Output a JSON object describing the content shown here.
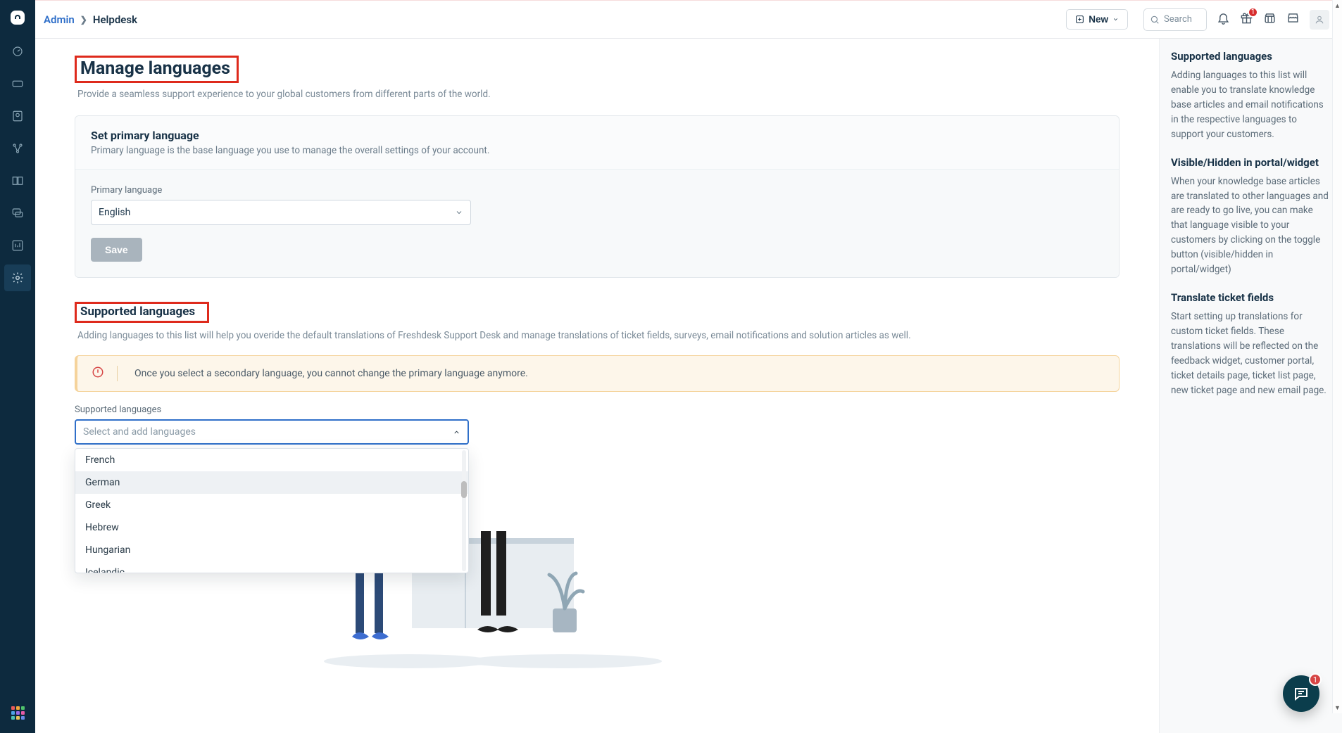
{
  "breadcrumb": {
    "admin": "Admin",
    "current": "Helpdesk"
  },
  "topbar": {
    "new_label": "New",
    "search_placeholder": "Search",
    "badge_count": "1"
  },
  "page": {
    "title": "Manage languages",
    "subtitle": "Provide a seamless support experience to your global customers from different parts of the world."
  },
  "primary_card": {
    "title": "Set primary language",
    "subtitle": "Primary language is the base language you use to manage the overall settings of your account.",
    "field_label": "Primary language",
    "value": "English",
    "save_label": "Save"
  },
  "supported_section": {
    "title": "Supported languages",
    "subtitle": "Adding languages to this list will help you overide the default translations of Freshdesk Support Desk and manage translations of ticket fields, surveys, email notifications and solution articles as well.",
    "warning": "Once you select a secondary language, you cannot change the primary language anymore.",
    "field_label": "Supported languages",
    "placeholder": "Select and add languages",
    "options": [
      "French",
      "German",
      "Greek",
      "Hebrew",
      "Hungarian",
      "Icelandic"
    ]
  },
  "help": {
    "h1": "Supported languages",
    "b1": "Adding languages to this list will enable you to translate knowledge base articles and email notifications in the respective languages to support your customers.",
    "h2": "Visible/Hidden in portal/widget",
    "b2": "When your knowledge base articles are translated to other languages and are ready to go live, you can make that language visible to your customers by clicking on the toggle button (visible/hidden in portal/widget)",
    "h3": "Translate ticket fields",
    "b3": "Start setting up translations for custom ticket fields. These translations will be reflected on the feedback widget, customer portal, ticket details page, ticket list page, new ticket page and new email page."
  },
  "chat": {
    "badge": "1"
  }
}
